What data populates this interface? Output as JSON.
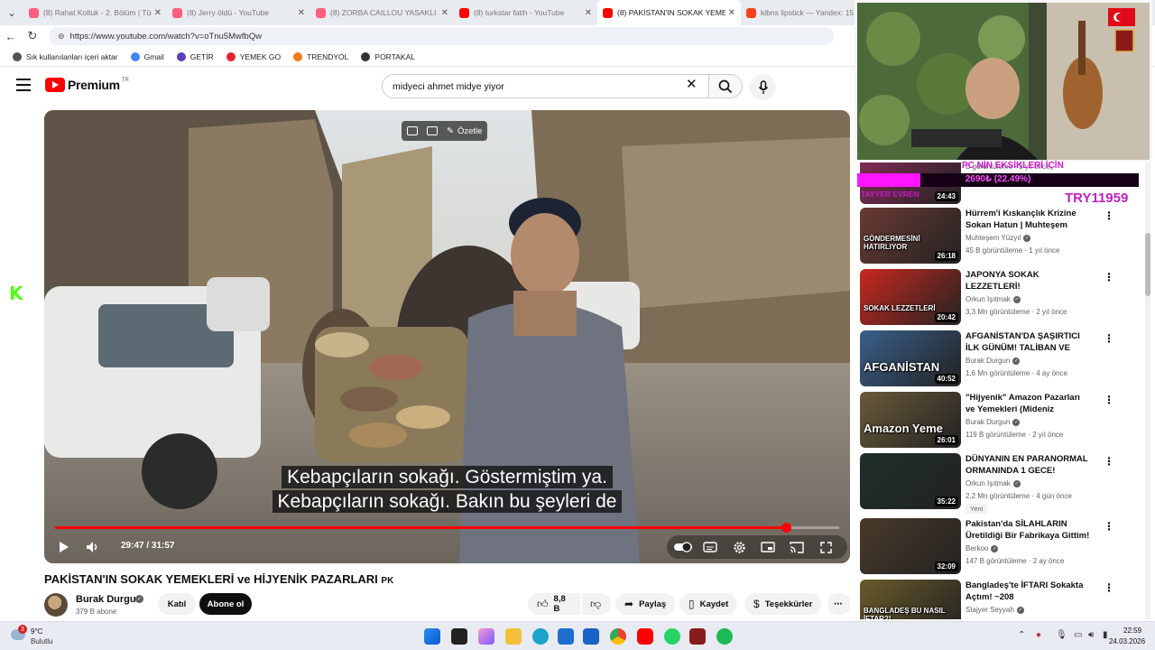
{
  "browser": {
    "tabs": [
      {
        "title": "(8) Rahat Koltuk - 2. Bölüm | Türkçe",
        "color": "#ff5f7e",
        "active": false
      },
      {
        "title": "(8) Jerry öldü - YouTube",
        "color": "#ff5f7e",
        "active": false
      },
      {
        "title": "(8) ZORBA CAILLOU YASAKLI BÖLÜM",
        "color": "#ff5f7e",
        "active": false
      },
      {
        "title": "(8) turkstar fatih - YouTube",
        "color": "#ff0000",
        "active": false
      },
      {
        "title": "(8) PAKİSTAN'IN SOKAK YEMEKLERİ",
        "color": "#ff0000",
        "active": true
      },
      {
        "title": "kibns lipstick — Yandex: 15",
        "color": "#fc3f1d",
        "active": false
      }
    ],
    "url": "https://www.youtube.com/watch?v=oTnu5MwfbQw",
    "bookmarks": [
      {
        "label": "Sık kullanılanları içeri aktar",
        "color": "#555555"
      },
      {
        "label": "Gmail",
        "color": "#4285f4"
      },
      {
        "label": "GETİR",
        "color": "#5d3ebc"
      },
      {
        "label": "YEMEK GO",
        "color": "#e3242b"
      },
      {
        "label": "TRENDYOL",
        "color": "#f27a1a"
      },
      {
        "label": "PORTAKAL",
        "color": "#333333"
      }
    ]
  },
  "youtube": {
    "logo": "Premium",
    "logo_cc": "TR",
    "search_query": "midyeci ahmet midye yiyor"
  },
  "player": {
    "summary_label": "Özetle",
    "subtitle_line1": "Kebapçıların sokağı. Göstermiştim ya.",
    "subtitle_line2": "Kebapçıların sokağı. Bakın bu şeyleri de",
    "time": "29:47 / 31:57",
    "progress": 0.9325
  },
  "video": {
    "title": "PAKİSTAN'IN SOKAK YEMEKLERİ ve HİJYENİK PAZARLARI",
    "title_flag": "PK",
    "channel": "Burak Durgun",
    "subscribers": "379 B abone",
    "join_label": "Katıl",
    "subscribe_label": "Abone ol",
    "likes": "8,8 B",
    "share_label": "Paylaş",
    "save_label": "Kaydet",
    "thanks_label": "Teşekkürler"
  },
  "recommendations": [
    {
      "title": "",
      "channel": "",
      "meta": "B görüntüleme · 3 yıl önce",
      "duration": "24:43",
      "color": "#8a2d5a"
    },
    {
      "title": "Hürrem'i Kıskançlık Krizine Sokan Hatun | Muhteşem Yüzyıl",
      "channel": "Muhteşem Yüzyıl",
      "meta": "45 B görüntüleme · 1 yıl önce",
      "duration": "26:18",
      "color": "#6b3a34",
      "label": "GÖNDERMESİNİ HATIRLIYOR"
    },
    {
      "title": "JAPONYA SOKAK LEZZETLERİ!",
      "channel": "Orkun Işıtmak",
      "meta": "3,3 Mn görüntüleme · 2 yıl önce",
      "duration": "20:42",
      "color": "#c8281e",
      "label": "SOKAK LEZZETLERİ"
    },
    {
      "title": "AFGANİSTAN'DA ŞAŞIRTICI İLK GÜNÜM! TALİBAN VE ŞERİAT ...",
      "channel": "Burak Durgun",
      "meta": "1,6 Mn görüntüleme · 4 ay önce",
      "duration": "40:52",
      "color": "#3a5f8a",
      "label": "AFGANİSTAN"
    },
    {
      "title": "\"Hijyenik\" Amazon Pazarları ve Yemekleri (Mideniz Kalkacak) ...",
      "channel": "Burak Durgun",
      "meta": "119 B görüntüleme · 2 yıl önce",
      "duration": "26:01",
      "color": "#6a5a3a",
      "label": "Amazon Yeme"
    },
    {
      "title": "DÜNYANIN EN PARANORMAL ORMANINDA 1 GECE!",
      "channel": "Orkun Işıtmak",
      "meta": "2,2 Mn görüntüleme · 4 gün önce",
      "duration": "35:22",
      "color": "#1f2f2a",
      "badge": "Yeni"
    },
    {
      "title": "Pakistan'da SİLAHLARIN Üretildiği Bir Fabrikaya Gittim!",
      "title_flag": "PK",
      "channel": "Berkoo",
      "meta": "147 B görüntüleme · 2 ay önce",
      "duration": "32:09",
      "color": "#4a3a2a"
    },
    {
      "title": "Bangladeş'te İFTARI Sokakta Açtım!  ~208",
      "channel": "Stajyer Seyyah",
      "meta": "",
      "duration": "",
      "color": "#6a5a2a",
      "label": "BANGLADEŞ BU NASIL İFTAR?!"
    }
  ],
  "overlay": {
    "donation_title": "PC NİN EKSİKLERİ İÇİN",
    "donation_amount": "2690₺ (22.49%)",
    "donation_progress": 0.2249,
    "donor": "TAYYER EVREN",
    "code": "TRY11959",
    "kick": "K"
  },
  "taskbar": {
    "weather_temp": "9°C",
    "weather_desc": "Bulutlu",
    "notifications": "3",
    "time": "22:59",
    "date": "24.03.2026"
  }
}
